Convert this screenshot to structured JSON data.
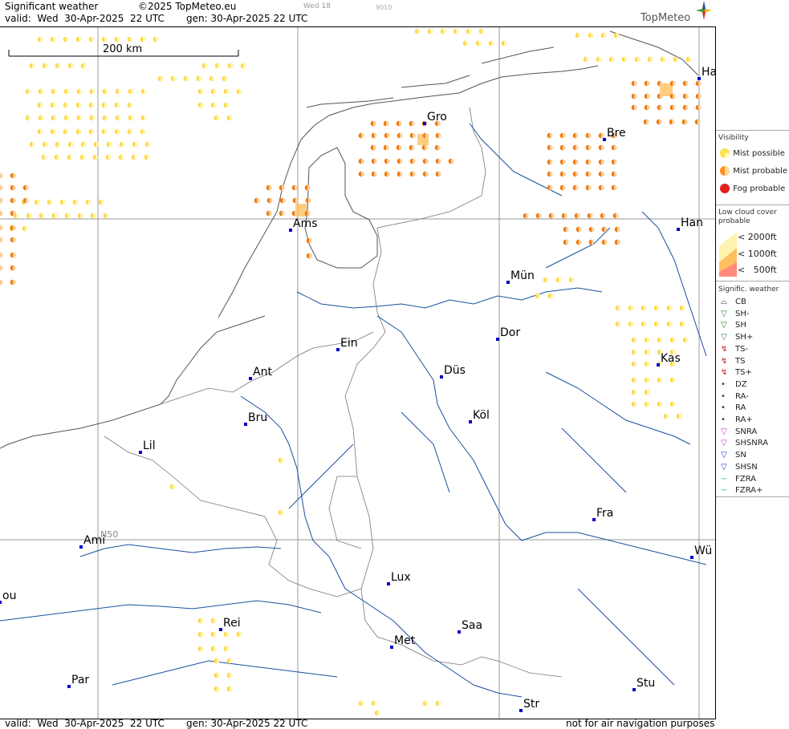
{
  "header": {
    "title": "Significant weather",
    "copyright": "©2025 TopMeteo.eu",
    "day_mark": "Wed 18",
    "code_mark": "9010",
    "valid": "valid:  Wed  30-Apr-2025  22 UTC",
    "generated": "gen: 30-Apr-2025 22 UTC",
    "brand": "TopMeteo"
  },
  "footer": {
    "valid": "valid:  Wed  30-Apr-2025  22 UTC",
    "generated": "gen: 30-Apr-2025 22 UTC",
    "disclaimer": "not for air navigation purposes"
  },
  "map": {
    "scale_label": "200 km",
    "latitude_label": "N50",
    "cities": [
      {
        "name": "Gro"
      },
      {
        "name": "Bre"
      },
      {
        "name": "Ha"
      },
      {
        "name": "Ams"
      },
      {
        "name": "Han"
      },
      {
        "name": "Mün"
      },
      {
        "name": "Dor"
      },
      {
        "name": "Ein"
      },
      {
        "name": "Kas"
      },
      {
        "name": "Ant"
      },
      {
        "name": "Düs"
      },
      {
        "name": "Bru"
      },
      {
        "name": "Köl"
      },
      {
        "name": "Lil"
      },
      {
        "name": "Fra"
      },
      {
        "name": "Ami"
      },
      {
        "name": "Wü"
      },
      {
        "name": "Lux"
      },
      {
        "name": "ou"
      },
      {
        "name": "Rei"
      },
      {
        "name": "Saa"
      },
      {
        "name": "Met"
      },
      {
        "name": "Par"
      },
      {
        "name": "Stu"
      },
      {
        "name": "Str"
      }
    ]
  },
  "legend": {
    "visibility": {
      "title": "Visibility",
      "items": [
        {
          "label": "Mist possible",
          "color": "#ffe14d"
        },
        {
          "label": "Mist probable",
          "color": "#ff8c1a"
        },
        {
          "label": "Fog probable",
          "color": "#e02020"
        }
      ]
    },
    "low_cloud": {
      "title": "Low cloud cover probable",
      "items": [
        {
          "label": "< 2000ft",
          "color": "#fff3b0"
        },
        {
          "label": "< 1000ft",
          "color": "#ffc060"
        },
        {
          "label": "<   500ft",
          "color": "#ff8a80"
        }
      ]
    },
    "signific": {
      "title": "Signific. weather",
      "items": [
        "CB",
        "SH-",
        "SH",
        "SH+",
        "TS-",
        "TS",
        "TS+",
        "DZ",
        "RA-",
        "RA",
        "RA+",
        "SNRA",
        "SHSNRA",
        "SN",
        "SHSN",
        "FZRA",
        "FZRA+"
      ]
    }
  }
}
